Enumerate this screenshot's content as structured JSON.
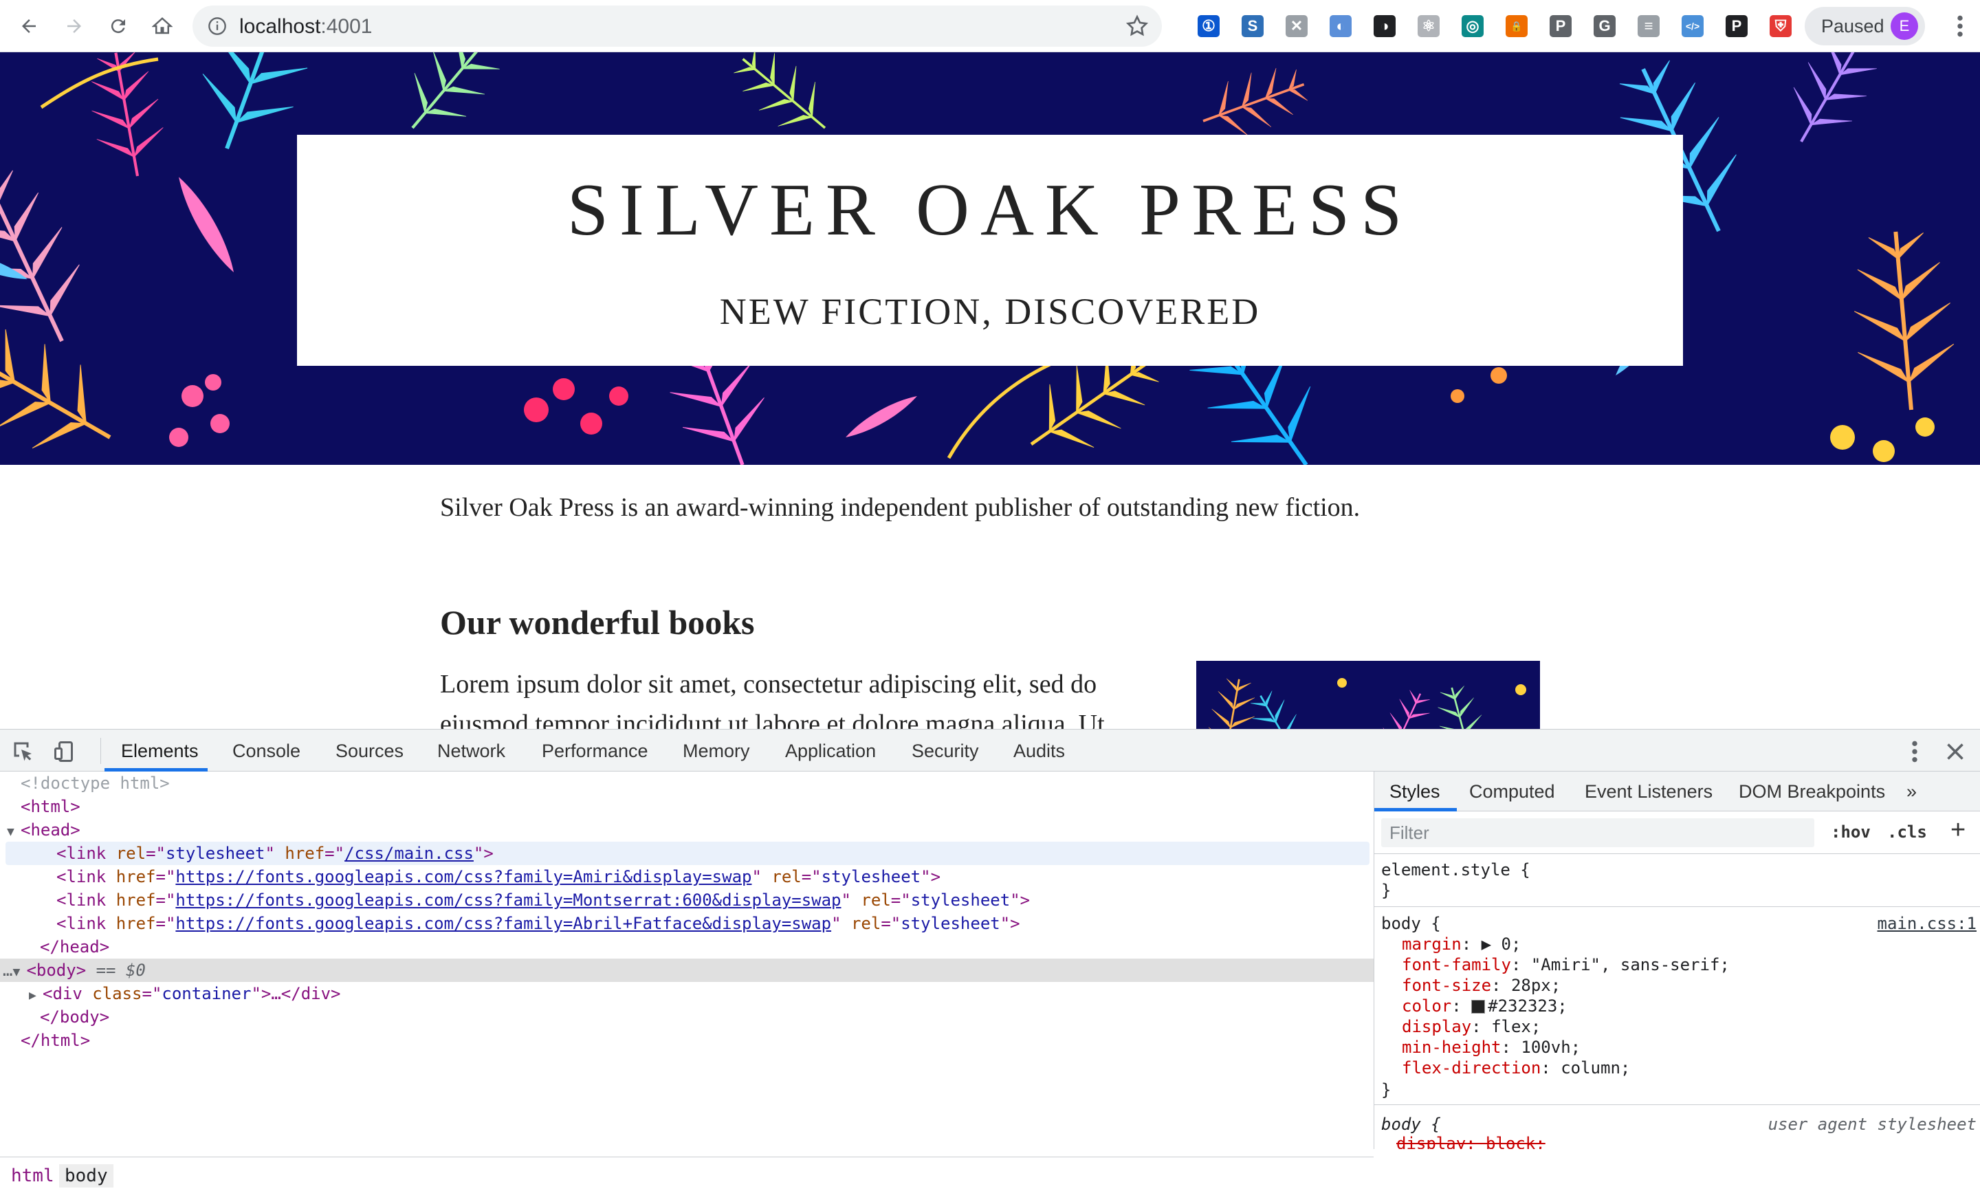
{
  "browser": {
    "url_host": "localhost",
    "url_port": ":4001",
    "profile_label": "Paused",
    "profile_initial": "E",
    "extensions": [
      {
        "name": "1password-icon",
        "glyph": "①",
        "bg": "#0a57d0"
      },
      {
        "name": "s-extension-icon",
        "glyph": "S",
        "bg": "#2e6fb7"
      },
      {
        "name": "x-extension-icon",
        "glyph": "✕",
        "bg": "#9aa0a6"
      },
      {
        "name": "blue-globe-icon",
        "glyph": "◐",
        "bg": "#5b8fd9"
      },
      {
        "name": "dark-mode-icon",
        "glyph": "◑",
        "bg": "#202124"
      },
      {
        "name": "react-devtools-icon",
        "glyph": "⚛",
        "bg": "#b0b3b8"
      },
      {
        "name": "teal-square-icon",
        "glyph": "◎",
        "bg": "#0b8a8a"
      },
      {
        "name": "lock-extension-icon",
        "glyph": "🔒",
        "bg": "#ef6c00"
      },
      {
        "name": "p-extension-icon",
        "glyph": "P",
        "bg": "#5f6368"
      },
      {
        "name": "g-extension-icon",
        "glyph": "G",
        "bg": "#5f6368"
      },
      {
        "name": "bars-extension-icon",
        "glyph": "≡",
        "bg": "#9aa0a6"
      },
      {
        "name": "code-extension-icon",
        "glyph": "</>",
        "bg": "#4a90d9"
      },
      {
        "name": "pinboard-icon",
        "glyph": "P",
        "bg": "#202124"
      },
      {
        "name": "shield-extension-icon",
        "glyph": "⛨",
        "bg": "#e53935"
      }
    ]
  },
  "page": {
    "title": "SILVER OAK PRESS",
    "subtitle": "NEW FICTION, DISCOVERED",
    "intro": "Silver Oak Press is an award-winning independent publisher of outstanding new fiction.",
    "section_heading": "Our wonderful books",
    "lorem": "Lorem ipsum dolor sit amet, consectetur adipiscing elit, sed do eiusmod tempor incididunt ut labore et dolore magna aliqua. Ut",
    "colors": {
      "hero_bg": "#0c0c5e",
      "text": "#232323"
    }
  },
  "devtools": {
    "tabs": [
      "Elements",
      "Console",
      "Sources",
      "Network",
      "Performance",
      "Memory",
      "Application",
      "Security",
      "Audits"
    ],
    "dom": {
      "doctype": "<!doctype html>",
      "html_open": "<html>",
      "head_open": "<head>",
      "link1_href": "/css/main.css",
      "link2_href": "https://fonts.googleapis.com/css?family=Amiri&display=swap",
      "link3_href": "https://fonts.googleapis.com/css?family=Montserrat:600&display=swap",
      "link4_href": "https://fonts.googleapis.com/css?family=Abril+Fatface&display=swap",
      "head_close": "</head>",
      "body_marker": "== $0",
      "div_class": "container",
      "body_close": "</body>",
      "html_close": "</html>"
    },
    "breadcrumbs": [
      "html",
      "body"
    ],
    "side_tabs": [
      "Styles",
      "Computed",
      "Event Listeners",
      "DOM Breakpoints",
      "»"
    ],
    "filter_placeholder": "Filter",
    "hov_label": ":hov",
    "cls_label": ".cls",
    "styles": {
      "element_style": "element.style {",
      "body_selector": "body {",
      "body_source": "main.css:1",
      "props": [
        {
          "name": "margin",
          "value": "▶ 0;"
        },
        {
          "name": "font-family",
          "value": "\"Amiri\", sans-serif;"
        },
        {
          "name": "font-size",
          "value": "28px;"
        },
        {
          "name": "color",
          "value": "#232323;"
        },
        {
          "name": "display",
          "value": "flex;"
        },
        {
          "name": "min-height",
          "value": "100vh;"
        },
        {
          "name": "flex-direction",
          "value": "column;"
        }
      ],
      "ua_selector": "body {",
      "ua_source": "user agent stylesheet",
      "ua_prop": "display: block;"
    }
  }
}
